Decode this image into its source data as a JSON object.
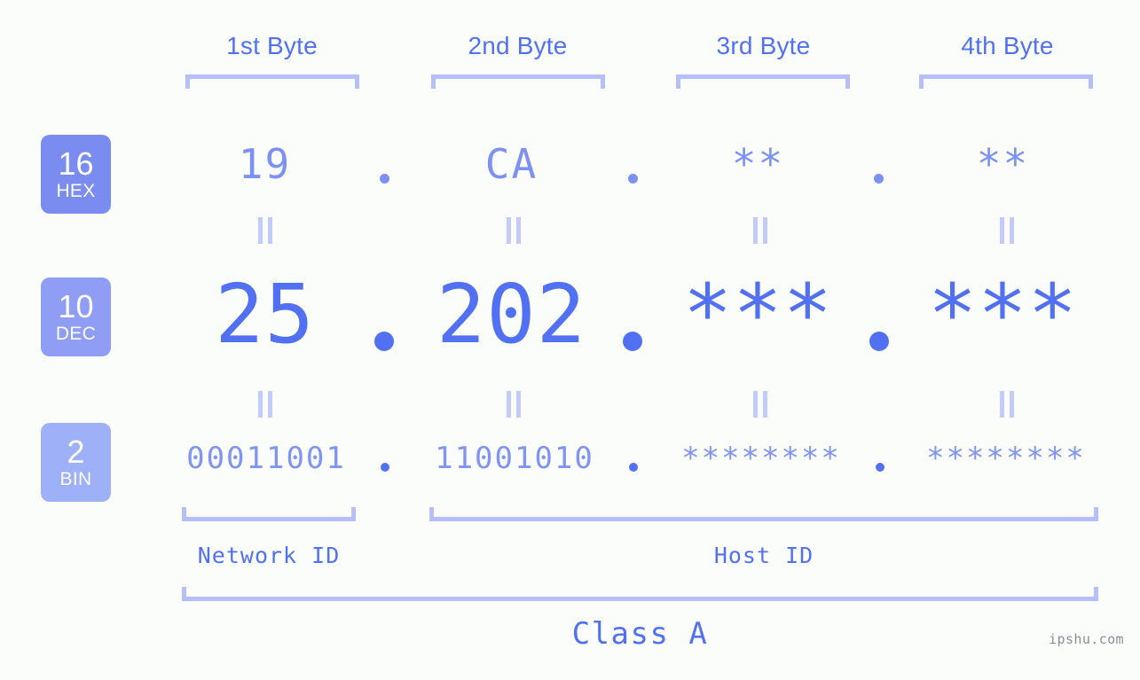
{
  "background_color": "#fbfdfa",
  "accent_color": "#5271f2",
  "accent_light": "#b6bffb",
  "byte_headers": [
    {
      "label": "1st Byte"
    },
    {
      "label": "2nd Byte"
    },
    {
      "label": "3rd Byte"
    },
    {
      "label": "4th Byte"
    }
  ],
  "bases": [
    {
      "number": "16",
      "name": "HEX",
      "color": "#7a8cf0"
    },
    {
      "number": "10",
      "name": "DEC",
      "color": "#8f9df5"
    },
    {
      "number": "2",
      "name": "BIN",
      "color": "#9eb0f8"
    }
  ],
  "rows": {
    "hex": {
      "bytes": [
        "19",
        "CA",
        "**",
        "**"
      ],
      "separator": "."
    },
    "dec": {
      "bytes": [
        "25",
        "202",
        "***",
        "***"
      ],
      "separator": "."
    },
    "bin": {
      "bytes": [
        "00011001",
        "11001010",
        "********",
        "********"
      ],
      "separator": "."
    }
  },
  "equals_symbol": "=",
  "sections": {
    "network_id": "Network ID",
    "host_id": "Host ID",
    "class": "Class A"
  },
  "watermark": "ipshu.com"
}
